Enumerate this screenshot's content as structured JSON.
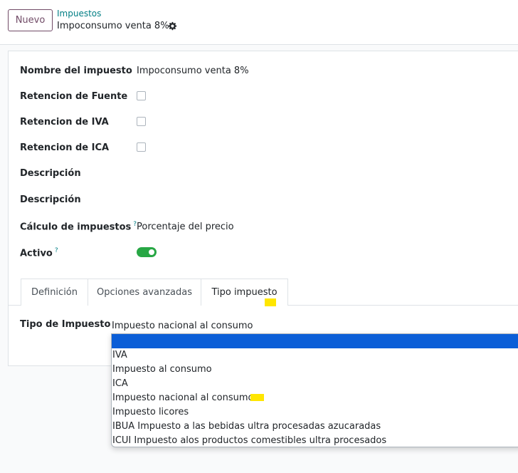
{
  "topbar": {
    "new_button": "Nuevo",
    "breadcrumb_parent": "Impuestos",
    "breadcrumb_current": "Impoconsumo venta 8%",
    "settings_icon": "gear-icon"
  },
  "form": {
    "tax_name_label": "Nombre del impuesto",
    "tax_name_value": "Impoconsumo venta 8%",
    "withholding_source_label": "Retencion de Fuente",
    "withholding_source_checked": false,
    "withholding_iva_label": "Retencion de IVA",
    "withholding_iva_checked": false,
    "withholding_ica_label": "Retencion de ICA",
    "withholding_ica_checked": false,
    "description_label_1": "Descripción",
    "description_label_2": "Descripción",
    "computation_label": "Cálculo de impuestos",
    "computation_help": "?",
    "computation_value": "Porcentaje del precio",
    "active_label": "Activo",
    "active_help": "?",
    "active_value": true
  },
  "tabs": [
    {
      "label": "Definición",
      "active": false
    },
    {
      "label": "Opciones avanzadas",
      "active": false
    },
    {
      "label": "Tipo impuesto",
      "active": true
    }
  ],
  "tax_type": {
    "label": "Tipo de Impuesto",
    "current_value": "Impuesto nacional al consumo",
    "options": [
      "",
      "IVA",
      "Impuesto al consumo",
      "ICA",
      "Impuesto nacional al consumo",
      "Impuesto licores",
      "IBUA Impuesto a las bebidas ultra procesadas azucaradas",
      "ICUI Impuesto alos productos comestibles ultra procesados"
    ],
    "highlighted_index": 0
  },
  "colors": {
    "accent": "#714b67",
    "link": "#017e84",
    "toggle_on": "#28a745",
    "selection": "#0b5ed7",
    "annotation_highlight": "#ffe600"
  }
}
